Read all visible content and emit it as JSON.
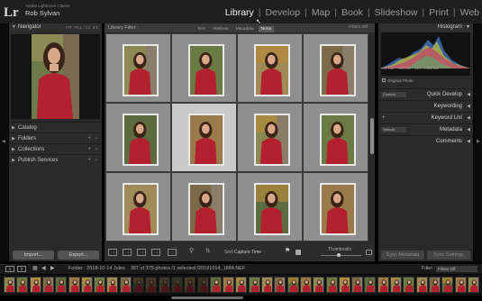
{
  "app": {
    "logo": "Lr",
    "product": "Adobe Lightroom Classic",
    "user": "Rob Sylvan"
  },
  "modules": [
    "Library",
    "Develop",
    "Map",
    "Book",
    "Slideshow",
    "Print",
    "Web"
  ],
  "active_module": "Library",
  "left_panel": {
    "navigator": {
      "title": "Navigator",
      "options": [
        "FIT",
        "FILL",
        "1:1",
        "3:1"
      ]
    },
    "sections": [
      {
        "label": "Catalog",
        "plus": false
      },
      {
        "label": "Folders",
        "plus": true
      },
      {
        "label": "Collections",
        "plus": true
      },
      {
        "label": "Publish Services",
        "plus": true
      }
    ],
    "import_label": "Import...",
    "export_label": "Export..."
  },
  "filter_bar": {
    "title": "Library Filter :",
    "tabs": [
      "Text",
      "Attribute",
      "Metadata",
      "None"
    ],
    "selected_tab": "None",
    "filters_off": "Filters Off"
  },
  "toolbar": {
    "sort_label": "Sort:",
    "sort_value": "Capture Time",
    "thumbnails_label": "Thumbnails"
  },
  "right_panel": {
    "histogram_title": "Histogram",
    "histogram_info": [
      "ISO 100",
      "120 mm",
      "f/4.0",
      "1/640 sec"
    ],
    "original_photo": "Original Photo",
    "quick_develop": {
      "preset": "Custom",
      "label": "Quick Develop"
    },
    "keywording": "Keywording",
    "keyword_list": "Keyword List",
    "metadata": {
      "preset": "Default",
      "label": "Metadata"
    },
    "comments": "Comments",
    "sync_metadata": "Sync Metadata",
    "sync_settings": "Sync Settings"
  },
  "filmstrip": {
    "page1": "1",
    "page2": "2",
    "folder_text": "Folder : 2018-10-14 Jules",
    "count_text": "367 of 375 photos /1 selected /20181014_1884.NEF",
    "filter_label": "Filter :",
    "filter_value": "Filters Off"
  },
  "grid_selected_index": 5,
  "colors": {
    "accent_background": "#c9c9c9",
    "cell_background": "#8f8f8f",
    "subject_shirt": "#b3212e"
  }
}
